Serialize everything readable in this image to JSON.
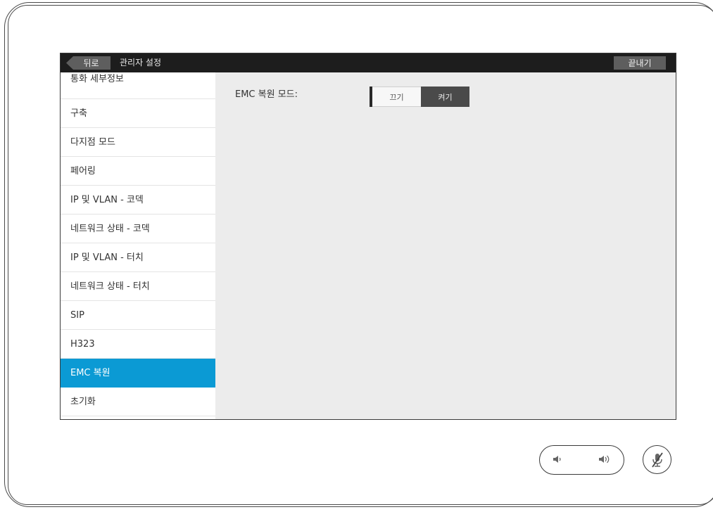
{
  "topbar": {
    "back_label": "뒤로",
    "title": "관리자 설정",
    "end_label": "끝내기"
  },
  "sidebar": {
    "items": [
      {
        "label": "통화 세부정보"
      },
      {
        "label": "구축"
      },
      {
        "label": "다지점 모드"
      },
      {
        "label": "페어링"
      },
      {
        "label": "IP 및 VLAN - 코덱"
      },
      {
        "label": "네트워크 상태 - 코덱"
      },
      {
        "label": "IP 및 VLAN - 터치"
      },
      {
        "label": "네트워크 상태 - 터치"
      },
      {
        "label": "SIP"
      },
      {
        "label": "H323"
      },
      {
        "label": "EMC 복원",
        "active": true
      },
      {
        "label": "초기화"
      }
    ]
  },
  "content": {
    "setting_label": "EMC 복원 모드:",
    "toggle": {
      "off_label": "끄기",
      "on_label": "켜기",
      "selected": "켜기"
    }
  },
  "controls": {
    "volume_down_icon": "volume-down-icon",
    "volume_up_icon": "volume-up-icon",
    "mute_icon": "microphone-muted-icon"
  },
  "colors": {
    "accent": "#0b9ad4",
    "topbar": "#1d1d1d"
  }
}
